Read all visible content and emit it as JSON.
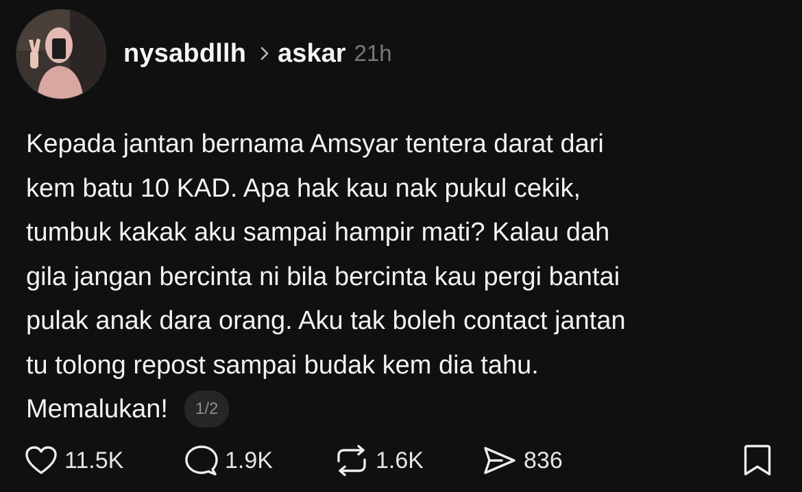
{
  "post": {
    "author": "nysabdllh",
    "topic": "askar",
    "time": "21h",
    "lines": [
      "Kepada jantan bernama Amsyar tentera darat dari",
      "kem batu 10 KAD. Apa hak kau nak pukul cekik,",
      "tumbuk kakak aku sampai hampir mati? Kalau dah",
      "gila jangan bercinta ni bila bercinta kau pergi bantai",
      "pulak anak dara orang. Aku tak boleh contact jantan",
      "tu tolong repost sampai budak kem dia tahu.",
      "Memalukan!"
    ],
    "page_indicator": "1/2"
  },
  "actions": {
    "like_count": "11.5K",
    "reply_count": "1.9K",
    "repost_count": "1.6K",
    "share_count": "836"
  },
  "icons": {
    "avatar": "avatar",
    "chevron": "chevron-right-icon",
    "like": "heart-icon",
    "reply": "comment-icon",
    "repost": "repost-icon",
    "share": "send-icon",
    "save": "bookmark-icon"
  },
  "colors": {
    "background": "#101010",
    "text": "#f3f3f3",
    "muted": "#7a7a7a",
    "badge_bg": "#262626"
  }
}
